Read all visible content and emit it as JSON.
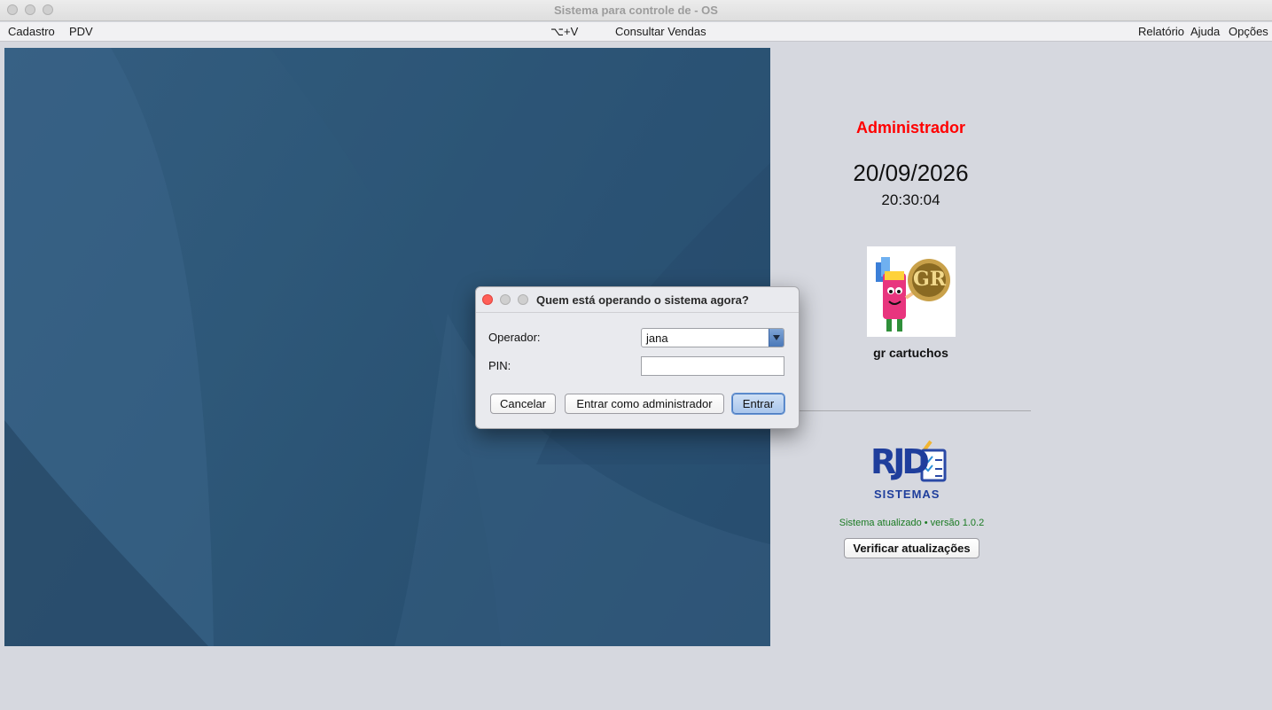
{
  "window": {
    "title": "Sistema para controle de - OS"
  },
  "menubar": {
    "left": [
      "Cadastro",
      "PDV"
    ],
    "center": [
      "⌥+V",
      "Consultar Vendas"
    ],
    "right": [
      "Relatório",
      "Ajuda",
      "Opções"
    ]
  },
  "info_panel": {
    "role": "Administrador",
    "date": "20/09/2026",
    "time": "20:30:04",
    "company_logo_text": "GR",
    "company_name": "gr cartuchos",
    "brand_logo_text": "RJD",
    "brand_logo_sub": "SISTEMAS",
    "update_status": "Sistema atualizado • versão 1.0.2",
    "check_updates_label": "Verificar atualizações"
  },
  "dialog": {
    "title": "Quem está operando o sistema agora?",
    "operator_label": "Operador:",
    "operator_value": "jana",
    "pin_label": "PIN:",
    "pin_value": "",
    "cancel_label": "Cancelar",
    "admin_label": "Entrar como administrador",
    "enter_label": "Entrar"
  },
  "colors": {
    "role_text": "#ff0000",
    "update_status_text": "#1a7a22",
    "close_button": "#ff5f57",
    "wallpaper": "#2e5879"
  }
}
